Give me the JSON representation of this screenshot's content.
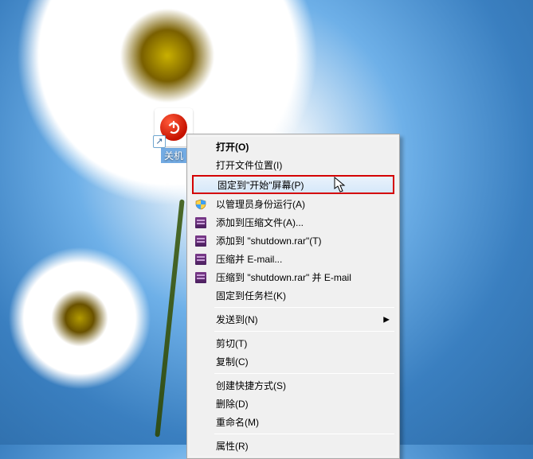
{
  "desktop_icon": {
    "label": "关机",
    "icon_name": "power-icon"
  },
  "context_menu": {
    "items": [
      {
        "label": "打开(O)",
        "bold": true,
        "icon": null
      },
      {
        "label": "打开文件位置(I)",
        "icon": null
      },
      {
        "label": "固定到\"开始\"屏幕(P)",
        "icon": null,
        "highlighted": true
      },
      {
        "label": "以管理员身份运行(A)",
        "icon": "shield-icon"
      },
      {
        "label": "添加到压缩文件(A)...",
        "icon": "archive-icon"
      },
      {
        "label": "添加到 \"shutdown.rar\"(T)",
        "icon": "archive-icon"
      },
      {
        "label": "压缩并 E-mail...",
        "icon": "archive-icon"
      },
      {
        "label": "压缩到 \"shutdown.rar\" 并 E-mail",
        "icon": "archive-icon"
      },
      {
        "label": "固定到任务栏(K)",
        "icon": null
      },
      {
        "separator": true
      },
      {
        "label": "发送到(N)",
        "icon": null,
        "submenu": true
      },
      {
        "separator": true
      },
      {
        "label": "剪切(T)",
        "icon": null
      },
      {
        "label": "复制(C)",
        "icon": null
      },
      {
        "separator": true
      },
      {
        "label": "创建快捷方式(S)",
        "icon": null
      },
      {
        "label": "删除(D)",
        "icon": null
      },
      {
        "label": "重命名(M)",
        "icon": null
      },
      {
        "separator": true
      },
      {
        "label": "属性(R)",
        "icon": null
      }
    ]
  }
}
